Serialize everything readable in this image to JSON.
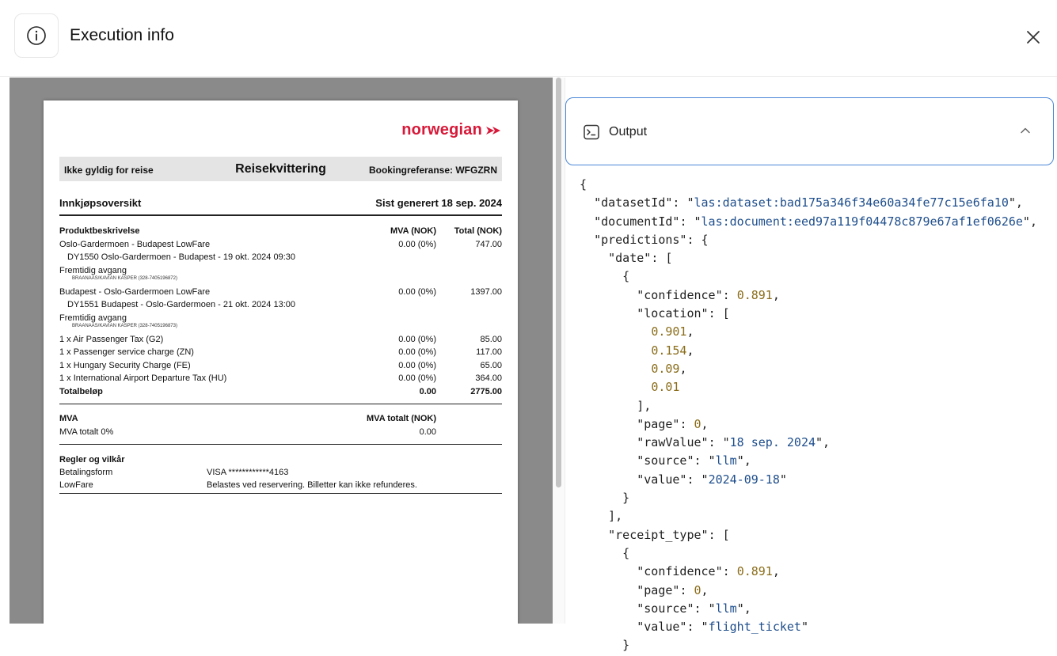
{
  "header": {
    "title": "Execution info"
  },
  "receipt": {
    "brand": "norwegian",
    "band_left": "Ikke gyldig for reise",
    "band_center": "Reisekvittering",
    "band_right": "Bookingreferanse: WFGZRN",
    "section1_title": "Innkjøpsoversikt",
    "generated": "Sist generert 18 sep. 2024",
    "col_desc": "Produktbeskrivelse",
    "col_mva": "MVA (NOK)",
    "col_total": "Total (NOK)",
    "flight1": {
      "title": "Oslo-Gardermoen - Budapest LowFare",
      "mva": "0.00 (0%)",
      "total": "747.00",
      "detail": "DY1550 Oslo-Gardermoen - Budapest - 19 okt. 2024 09:30",
      "status": "Fremtidig avgang",
      "passenger": "BRAANAAS/KAVIAN KASPER (328-7405196872)"
    },
    "flight2": {
      "title": "Budapest - Oslo-Gardermoen LowFare",
      "mva": "0.00 (0%)",
      "total": "1397.00",
      "detail": "DY1551 Budapest - Oslo-Gardermoen - 21 okt. 2024 13:00",
      "status": "Fremtidig avgang",
      "passenger": "BRAANAAS/KAVIAN KASPER (328-7405196873)"
    },
    "fees": [
      {
        "label": "1 x Air Passenger Tax (G2)",
        "mva": "0.00 (0%)",
        "total": "85.00"
      },
      {
        "label": "1 x Passenger service charge (ZN)",
        "mva": "0.00 (0%)",
        "total": "117.00"
      },
      {
        "label": "1 x Hungary Security Charge (FE)",
        "mva": "0.00 (0%)",
        "total": "65.00"
      },
      {
        "label": "1 x International Airport Departure Tax (HU)",
        "mva": "0.00 (0%)",
        "total": "364.00"
      }
    ],
    "total_label": "Totalbeløp",
    "total_mva": "0.00",
    "total_sum": "2775.00",
    "mva_title": "MVA",
    "mva_col": "MVA totalt (NOK)",
    "mva_row_label": "MVA totalt 0%",
    "mva_row_value": "0.00",
    "terms_title": "Regler og vilkår",
    "payment_label": "Betalingsform",
    "payment_value": "VISA ************4163",
    "fare_label": "LowFare",
    "fare_value": "Belastes ved reservering. Billetter kan ikke refunderes."
  },
  "output": {
    "label": "Output",
    "json": {
      "datasetId": "las:dataset:bad175a346f34e60a34fe77c15e6fa10",
      "documentId": "las:document:eed97a119f04478c879e67af1ef0626e",
      "date_confidence": "0.891",
      "location": [
        "0.901",
        "0.154",
        "0.09",
        "0.01"
      ],
      "date_page": "0",
      "rawValue": "18 sep. 2024",
      "date_source": "llm",
      "date_value": "2024-09-18",
      "receipt_confidence": "0.891",
      "receipt_page": "0",
      "receipt_source": "llm",
      "receipt_value": "flight_ticket"
    }
  }
}
